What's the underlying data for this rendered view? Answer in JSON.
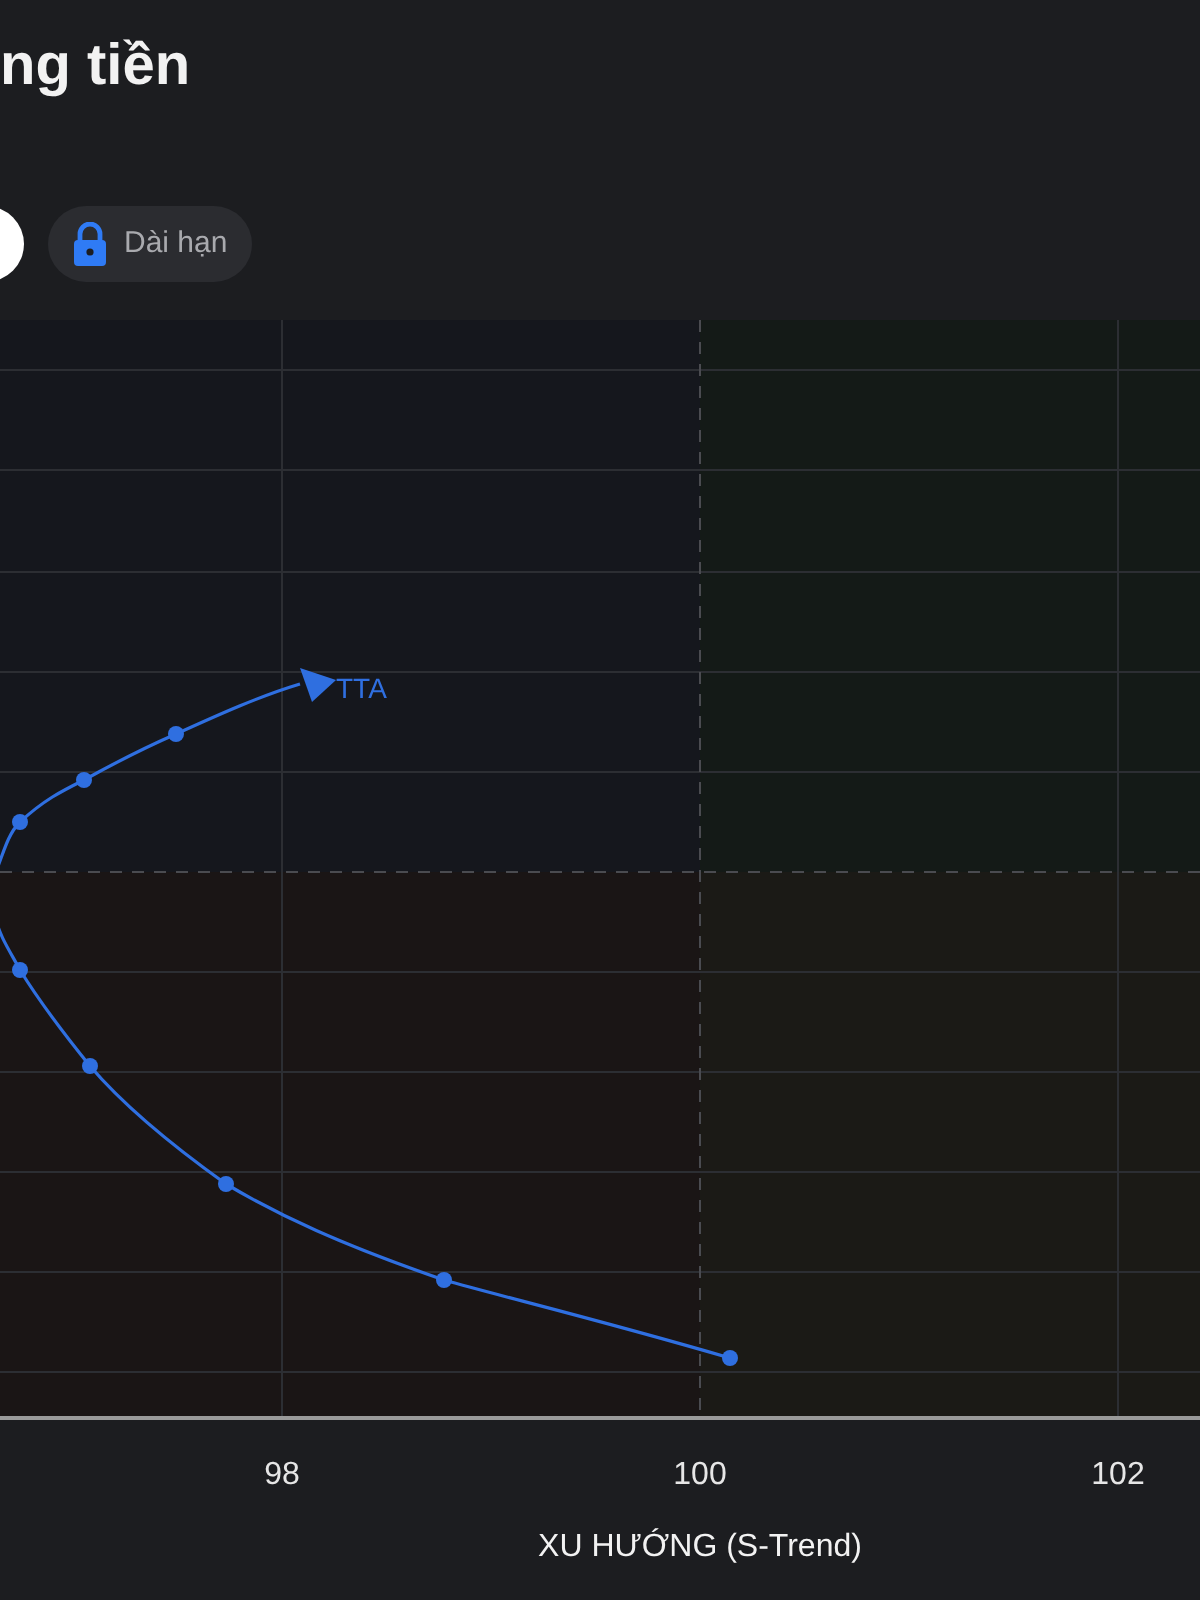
{
  "header": {
    "title": "ng tiền",
    "chips": [
      {
        "selected": true
      },
      {
        "label": "Dài hạn",
        "selected": false,
        "locked": true
      }
    ]
  },
  "chart": {
    "series_label": "TTA",
    "xticks": [
      "98",
      "100",
      "102"
    ],
    "xlabel": "XU HƯỚNG (S-Trend)"
  }
}
